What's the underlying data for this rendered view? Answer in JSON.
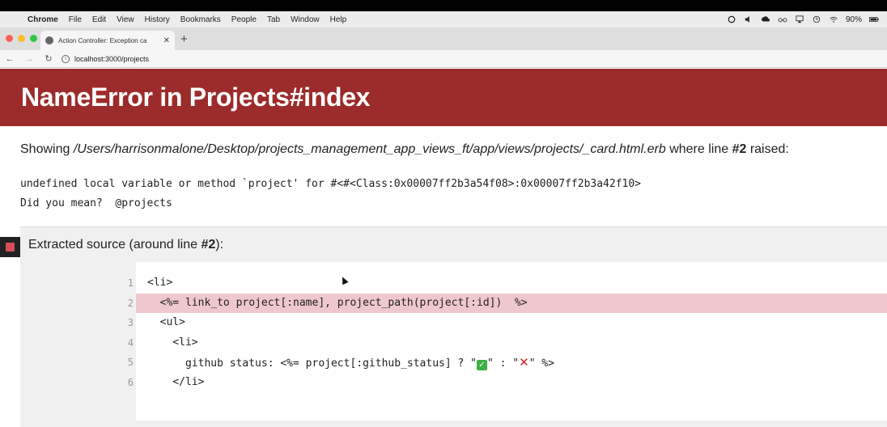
{
  "menubar": {
    "app": "Chrome",
    "items": [
      "File",
      "Edit",
      "View",
      "History",
      "Bookmarks",
      "People",
      "Tab",
      "Window",
      "Help"
    ],
    "battery": "90%"
  },
  "browser": {
    "tab_title": "Action Controller: Exception ca",
    "url": "localhost:3000/projects",
    "traffic_lights": [
      "#fc5f57",
      "#fdbc2e",
      "#33c748"
    ]
  },
  "error": {
    "title": "NameError in Projects#index",
    "showing_prefix": "Showing ",
    "path": "/Users/harrisonmalone/Desktop/projects_management_app_views_ft/app/views/projects/_card.html.erb",
    "showing_middle": " where line ",
    "line_ref": "#2",
    "showing_suffix": " raised:",
    "message_line1": "undefined local variable or method `project' for #<#<Class:0x00007ff2b3a54f08>:0x00007ff2b3a42f10>",
    "message_line2": "Did you mean?  @projects",
    "header_color": "#9c2b2b"
  },
  "extract": {
    "title_prefix": "Extracted source (around line ",
    "title_line": "#2",
    "title_suffix": "):",
    "line_numbers": [
      "1",
      "2",
      "3",
      "4",
      "5",
      "6"
    ],
    "lines": {
      "l1": "<li>",
      "l2": "  <%= link_to project[:name], project_path(project[:id])  %>",
      "l3": "  <ul>",
      "l4": "    <li>",
      "l5_a": "      github status: <%= project[:github_status] ? \"",
      "l5_check": "✓",
      "l5_b": "\" : \"",
      "l5_cross": "✕",
      "l5_c": "\" %>",
      "l6": "    </li>"
    },
    "highlight_line": 2
  }
}
